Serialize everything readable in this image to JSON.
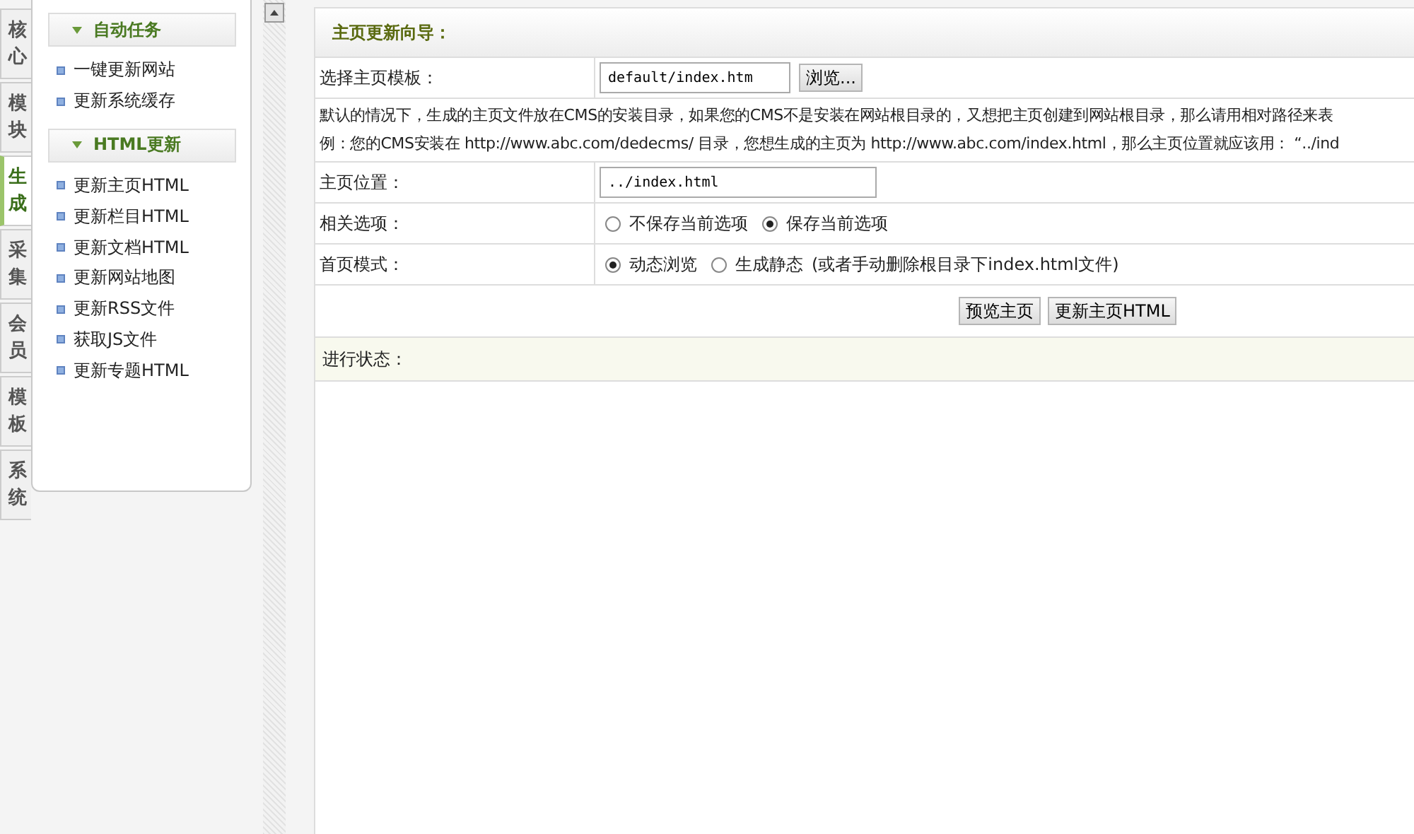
{
  "side_tabs": [
    {
      "label": "核心",
      "selected": false
    },
    {
      "label": "模块",
      "selected": false
    },
    {
      "label": "生成",
      "selected": true
    },
    {
      "label": "采集",
      "selected": false
    },
    {
      "label": "会员",
      "selected": false
    },
    {
      "label": "模板",
      "selected": false
    },
    {
      "label": "系统",
      "selected": false
    }
  ],
  "sidebar": {
    "sections": [
      {
        "title": "自动任务",
        "items": [
          "一键更新网站",
          "更新系统缓存"
        ]
      },
      {
        "title": "HTML更新",
        "items": [
          "更新主页HTML",
          "更新栏目HTML",
          "更新文档HTML",
          "更新网站地图",
          "更新RSS文件",
          "获取JS文件",
          "更新专题HTML"
        ]
      }
    ]
  },
  "wizard": {
    "title": "主页更新向导：",
    "rows": [
      {
        "kind": "input",
        "label": "选择主页模板：",
        "value": "default/index.htm",
        "button": "浏览..."
      },
      {
        "kind": "note",
        "lines": [
          "默认的情况下，生成的主页文件放在CMS的安装目录，如果您的CMS不是安装在网站根目录的，又想把主页创建到网站根目录，那么请用相对路径来表",
          "例：您的CMS安装在 http://www.abc.com/dedecms/ 目录，您想生成的主页为 http://www.abc.com/index.html，那么主页位置就应该用： “../ind"
        ]
      },
      {
        "kind": "input",
        "label": "主页位置：",
        "value": "../index.html"
      },
      {
        "kind": "radio",
        "label": "相关选项：",
        "options": [
          {
            "label": "不保存当前选项",
            "selected": false
          },
          {
            "label": "保存当前选项",
            "selected": true
          }
        ]
      },
      {
        "kind": "radio",
        "label": "首页模式：",
        "options": [
          {
            "label": "动态浏览",
            "selected": true
          },
          {
            "label": "生成静态",
            "selected": false
          }
        ],
        "note": "(或者手动删除根目录下index.html文件)"
      }
    ],
    "buttons": [
      "预览主页",
      "更新主页HTML"
    ],
    "status_label": "进行状态："
  }
}
